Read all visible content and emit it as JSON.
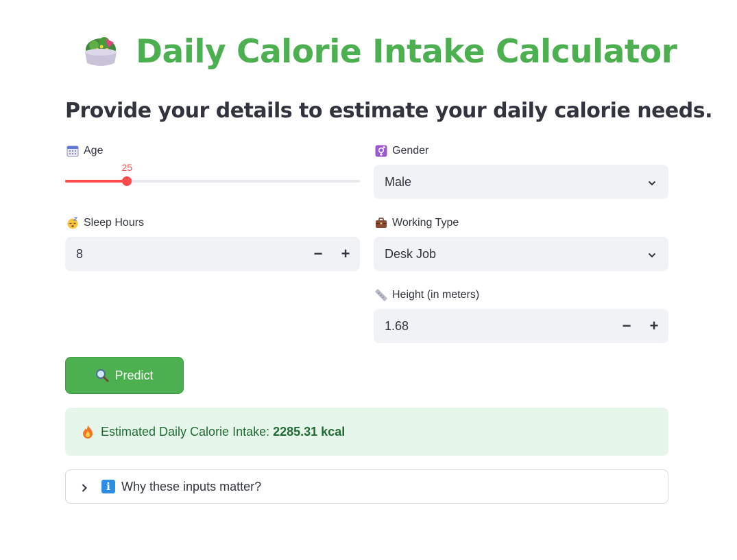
{
  "header": {
    "title": "Daily Calorie Intake Calculator",
    "icon": "salad-bowl-icon",
    "title_color": "#4caf50"
  },
  "subtitle": "Provide your details to estimate your daily calorie needs.",
  "age": {
    "label": "Age",
    "icon": "calendar-icon",
    "value": "25",
    "fraction": 0.21,
    "accent_color": "#ff4b4b"
  },
  "gender": {
    "label": "Gender",
    "icon": "gender-symbol-icon",
    "selected": "Male"
  },
  "sleep": {
    "label": "Sleep Hours",
    "icon": "sleeping-face-icon",
    "value": "8",
    "minus": "−",
    "plus": "+"
  },
  "working": {
    "label": "Working Type",
    "icon": "briefcase-icon",
    "selected": "Desk Job"
  },
  "height": {
    "label": "Height (in meters)",
    "icon": "ruler-icon",
    "value": "1.68",
    "minus": "−",
    "plus": "+"
  },
  "predict": {
    "label": "Predict",
    "icon": "magnifying-glass-icon",
    "color": "#4caf50"
  },
  "result": {
    "icon": "fire-icon",
    "label": "Estimated Daily Calorie Intake:",
    "value": "2285.31 kcal",
    "background": "#e6f6ea"
  },
  "expander": {
    "icon": "info-icon",
    "info_glyph": "i",
    "label": "Why these inputs matter?"
  }
}
